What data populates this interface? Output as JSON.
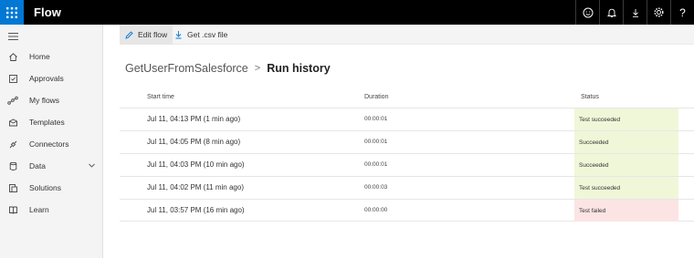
{
  "app": {
    "title": "Flow"
  },
  "topbar": {
    "icons": [
      "waffle-icon",
      "smiley-icon",
      "bell-icon",
      "download-icon",
      "gear-icon",
      "help-icon"
    ],
    "help_label": "?"
  },
  "sidebar": {
    "items": [
      {
        "label": "Home",
        "icon": "home-icon"
      },
      {
        "label": "Approvals",
        "icon": "approvals-icon"
      },
      {
        "label": "My flows",
        "icon": "flows-icon"
      },
      {
        "label": "Templates",
        "icon": "templates-icon"
      },
      {
        "label": "Connectors",
        "icon": "connectors-icon"
      },
      {
        "label": "Data",
        "icon": "data-icon"
      },
      {
        "label": "Solutions",
        "icon": "solutions-icon"
      },
      {
        "label": "Learn",
        "icon": "learn-icon"
      }
    ]
  },
  "commands": {
    "edit_flow": "Edit flow",
    "get_csv": "Get .csv file"
  },
  "breadcrumb": {
    "parent": "GetUserFromSalesforce",
    "separator": ">",
    "current": "Run history"
  },
  "table": {
    "headers": {
      "start": "Start time",
      "duration": "Duration",
      "status": "Status"
    },
    "rows": [
      {
        "start": "Jul 11, 04:13 PM (1 min ago)",
        "duration": "00:00:01",
        "status": "Test succeeded",
        "state": "ok"
      },
      {
        "start": "Jul 11, 04:05 PM (8 min ago)",
        "duration": "00:00:01",
        "status": "Succeeded",
        "state": "ok"
      },
      {
        "start": "Jul 11, 04:03 PM (10 min ago)",
        "duration": "00:00:01",
        "status": "Succeeded",
        "state": "ok"
      },
      {
        "start": "Jul 11, 04:02 PM (11 min ago)",
        "duration": "00:00:03",
        "status": "Test succeeded",
        "state": "ok"
      },
      {
        "start": "Jul 11, 03:57 PM (16 min ago)",
        "duration": "00:00:00",
        "status": "Test failed",
        "state": "fail"
      }
    ]
  },
  "colors": {
    "topbar": "#000000",
    "waffle": "#0078d4",
    "success_bg": "#f0f7d9",
    "fail_bg": "#fce4e4"
  }
}
